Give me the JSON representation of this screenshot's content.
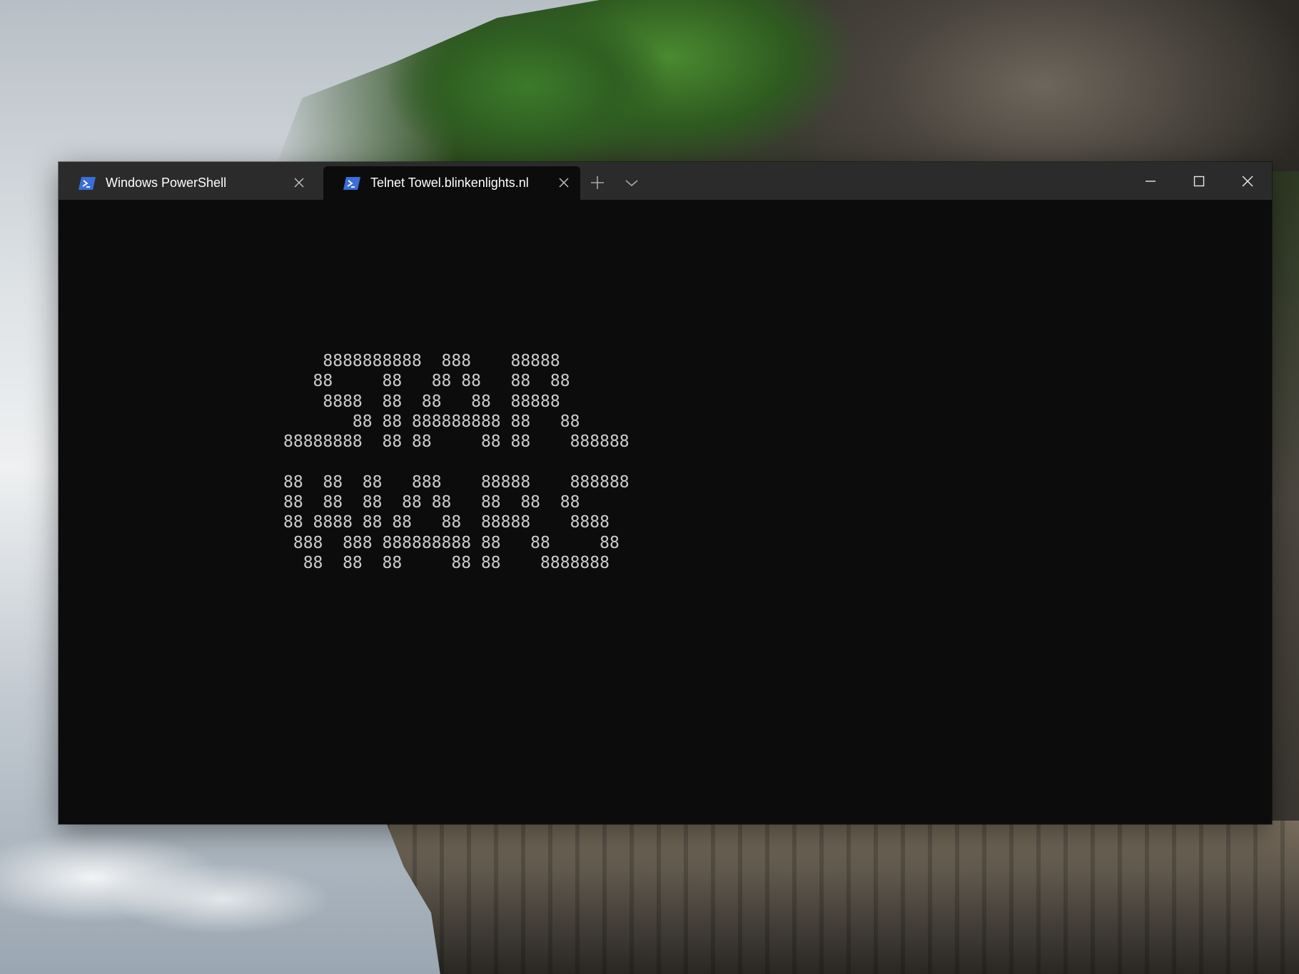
{
  "window": {
    "tabs": [
      {
        "label": "Windows PowerShell",
        "icon": "powershell-icon",
        "active": false
      },
      {
        "label": "Telnet Towel.blinkenlights.nl",
        "icon": "powershell-icon",
        "active": true
      }
    ],
    "controls": {
      "new_tab_icon": "plus-icon",
      "dropdown_icon": "chevron-down-icon",
      "minimize_icon": "minimize-icon",
      "maximize_icon": "maximize-icon",
      "close_icon": "close-icon"
    },
    "colors": {
      "titlebar": "#2b2b2b",
      "terminal_background": "#0c0c0c",
      "terminal_text": "#cccccc",
      "powershell_blue": "#3a6fd8"
    }
  },
  "terminal": {
    "lines": [
      "    8888888888  888    88888",
      "   88     88   88 88   88  88",
      "    8888  88  88   88  88888",
      "       88 88 888888888 88   88",
      "88888888  88 88     88 88    888888",
      "",
      "88  88  88   888    88888    888888",
      "88  88  88  88 88   88  88  88",
      "88 8888 88 88   88  88888    8888",
      " 888  888 888888888 88   88     88",
      "  88  88  88     88 88    8888888"
    ]
  }
}
